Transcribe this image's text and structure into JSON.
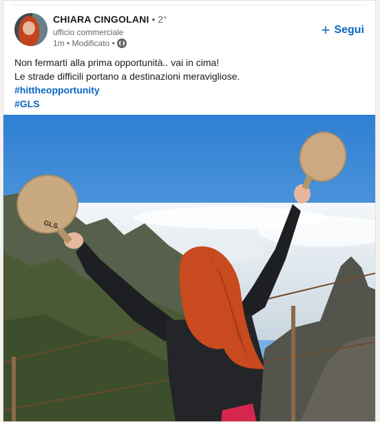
{
  "post": {
    "author": {
      "name": "CHIARA CINGOLANI",
      "degree": "• 2°",
      "headline": "ufficio commerciale",
      "meta": "1m • Modificato •"
    },
    "follow_label": "Segui",
    "follow_plus": "+",
    "lines": [
      "Non fermarti alla prima opportunità.. vai in cima!",
      "Le strade difficili portano a destinazioni meravigliose."
    ],
    "hashtags": [
      "#hittheopportunity",
      "#GLS"
    ],
    "paddle_text": "GLS."
  },
  "colors": {
    "link": "#0a66c2",
    "sky": "#3f86d2",
    "hair": "#c94a1e"
  },
  "icons": {
    "visibility": "globe-icon",
    "follow": "plus-icon"
  }
}
